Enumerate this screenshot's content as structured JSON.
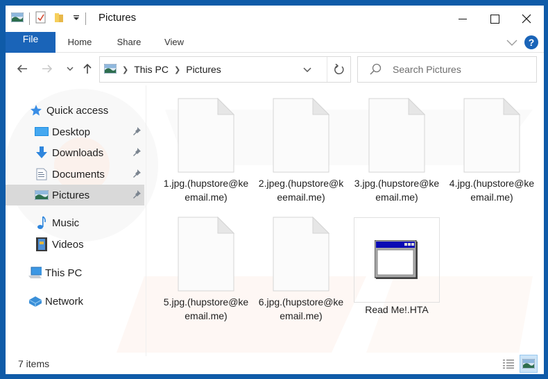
{
  "window": {
    "title": "Pictures",
    "controls": {
      "minimize": "minimize",
      "maximize": "maximize",
      "close": "close"
    }
  },
  "ribbon": {
    "tabs": [
      {
        "label": "File",
        "active": true
      },
      {
        "label": "Home"
      },
      {
        "label": "Share"
      },
      {
        "label": "View"
      }
    ],
    "help_label": "?"
  },
  "navigation": {
    "breadcrumb": [
      "This PC",
      "Pictures"
    ],
    "search_placeholder": "Search Pictures"
  },
  "sidebar": {
    "quick_access": {
      "label": "Quick access",
      "icon": "star-icon"
    },
    "pinned": [
      {
        "label": "Desktop",
        "icon": "desktop-icon",
        "pinned": true
      },
      {
        "label": "Downloads",
        "icon": "download-icon",
        "pinned": true
      },
      {
        "label": "Documents",
        "icon": "documents-icon",
        "pinned": true
      },
      {
        "label": "Pictures",
        "icon": "pictures-icon",
        "pinned": true,
        "selected": true
      },
      {
        "label": "Music",
        "icon": "music-icon"
      },
      {
        "label": "Videos",
        "icon": "videos-icon"
      }
    ],
    "this_pc": {
      "label": "This PC",
      "icon": "computer-icon"
    },
    "network": {
      "label": "Network",
      "icon": "network-icon"
    }
  },
  "files": [
    {
      "name": "1.jpg.(hupstore@keemail.me)",
      "icon": "blank-file-icon"
    },
    {
      "name": "2.jpeg.(hupstore@keemail.me)",
      "icon": "blank-file-icon"
    },
    {
      "name": "3.jpg.(hupstore@keemail.me)",
      "icon": "blank-file-icon"
    },
    {
      "name": "4.jpg.(hupstore@keemail.me)",
      "icon": "blank-file-icon"
    },
    {
      "name": "5.jpg.(hupstore@keemail.me)",
      "icon": "blank-file-icon"
    },
    {
      "name": "6.jpg.(hupstore@keemail.me)",
      "icon": "blank-file-icon"
    },
    {
      "name": "Read Me!.HTA",
      "icon": "hta-app-icon"
    }
  ],
  "status": {
    "item_count": "7 items"
  },
  "colors": {
    "accent": "#1a64b8",
    "frame": "#0f5ba8",
    "selected_bg": "#d9d9d9"
  }
}
